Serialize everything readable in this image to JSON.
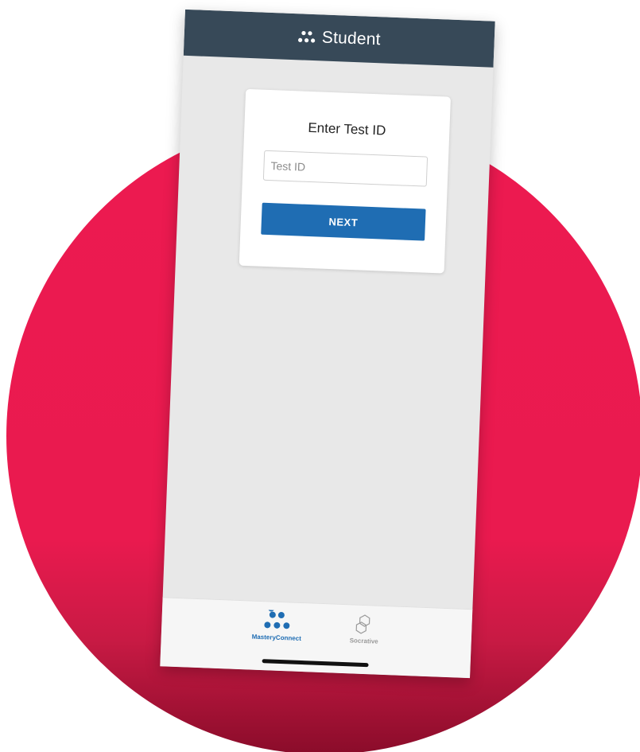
{
  "header": {
    "title": "Student",
    "icon": "mastery-dots-icon"
  },
  "card": {
    "title": "Enter Test ID",
    "input": {
      "value": "",
      "placeholder": "Test ID"
    },
    "next_label": "NEXT"
  },
  "tabbar": {
    "items": [
      {
        "label": "MasteryConnect",
        "icon": "masteryconnect-icon",
        "active": true
      },
      {
        "label": "Socrative",
        "icon": "socrative-icon",
        "active": false
      }
    ]
  },
  "colors": {
    "header_bg": "#374958",
    "accent": "#1f6db3",
    "background_circle": "#ec1a50",
    "app_bg": "#e8e8e8"
  }
}
